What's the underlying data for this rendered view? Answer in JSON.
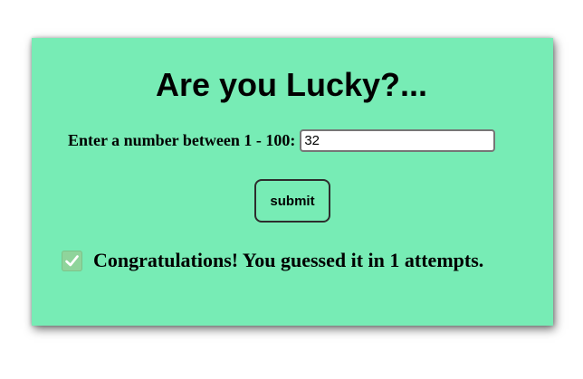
{
  "game": {
    "title": "Are you Lucky?...",
    "prompt_label": "Enter a number between 1 - 100:",
    "guess_value": "32",
    "submit_label": "submit",
    "result_message": "Congratulations! You guessed it in 1 attempts.",
    "result_icon": "check-mark-icon"
  },
  "colors": {
    "card_background": "#77ecb5",
    "check_icon_background": "#8fd49b"
  }
}
